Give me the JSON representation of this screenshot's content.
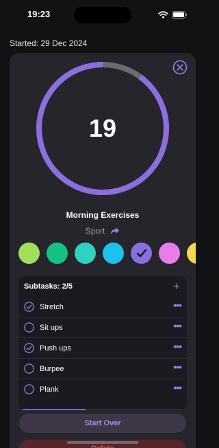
{
  "status_bar": {
    "time": "19:23",
    "icons": [
      "wifi-icon",
      "battery-icon"
    ]
  },
  "header": {
    "started": "Started: 29 Dec 2024"
  },
  "timer": {
    "value": "19",
    "progress_fraction": 0.9,
    "accent": "#8b6fe0",
    "remainder": "#6b6a6f"
  },
  "task": {
    "title": "Morning Exercises",
    "category": "Sport"
  },
  "colors": {
    "options": [
      "#a3e05a",
      "#13c283",
      "#2ed3c0",
      "#1ec0ec",
      "#8b6fe0",
      "#e57ee8",
      "#f5d94a"
    ],
    "selected_index": 4
  },
  "subtasks": {
    "header": "Subtasks: 2/5",
    "items": [
      {
        "label": "Stretch",
        "done": true
      },
      {
        "label": "Sit ups",
        "done": false
      },
      {
        "label": "Push ups",
        "done": true
      },
      {
        "label": "Burpee",
        "done": false
      },
      {
        "label": "Plank",
        "done": false
      }
    ],
    "progress_fraction": 0.4
  },
  "actions": {
    "start_over": "Start Over",
    "delete": "Delete"
  }
}
